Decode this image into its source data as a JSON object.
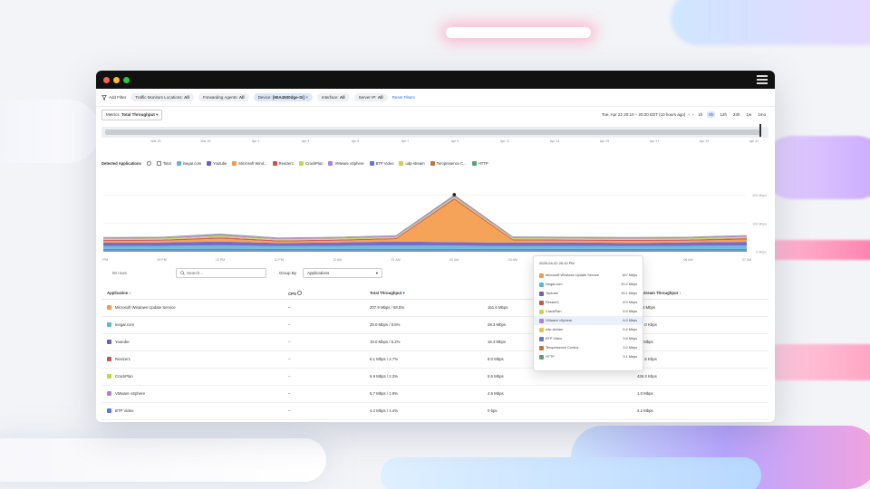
{
  "window": {
    "menu_icon": "hamburger-icon"
  },
  "filters": {
    "add_filter": "Add Filter",
    "chips": [
      {
        "label": "Traffic Monitors Locations:",
        "value": "All"
      },
      {
        "label": "Forwarding Agents:",
        "value": "All"
      },
      {
        "label": "Device:",
        "value": "[MIA4500dge-SI]"
      },
      {
        "label": "Interface:",
        "value": "All"
      },
      {
        "label": "Server IP:",
        "value": "All"
      }
    ],
    "reset": "Reset Filters"
  },
  "metrics": {
    "label": "Metrics:",
    "value": "Total Throughput",
    "time_range": "Tue, Apr 22 20:10 – 20:20 EDT (10 hours ago)",
    "buttons": [
      "1h",
      "6h",
      "12h",
      "24h",
      "1w",
      "1mo"
    ],
    "active_button": "6h"
  },
  "timeline": {
    "labels": [
      "Mar 28",
      "Mar 30",
      "Apr 1",
      "Apr 3",
      "Apr 5",
      "Apr 7",
      "Apr 9",
      "Apr 11",
      "Apr 13",
      "Apr 15",
      "Apr 17",
      "Apr 19",
      "Apr 21"
    ]
  },
  "legend": {
    "title": "Detected Applications",
    "total_label": "Total",
    "items": [
      {
        "name": "inegar.com",
        "color": "#5fb7d7"
      },
      {
        "name": "Youtube",
        "color": "#6d5ec4"
      },
      {
        "name": "Microsoft Wind...",
        "color": "#f39b4b"
      },
      {
        "name": "Resizer1",
        "color": "#d0504e"
      },
      {
        "name": "CrackPlan",
        "color": "#c6d64a"
      },
      {
        "name": "VMware vSphere",
        "color": "#b07fd6"
      },
      {
        "name": "BTP Video",
        "color": "#5b7ad6"
      },
      {
        "name": "udp-stream",
        "color": "#e7c547"
      },
      {
        "name": "Teropresence C...",
        "color": "#bf7445"
      },
      {
        "name": "HTTP",
        "color": "#5aa07a"
      }
    ]
  },
  "chart_data": {
    "type": "area",
    "x": [
      "08 PM",
      "09 PM",
      "10 PM",
      "11 PM",
      "12 AM",
      "01 AM",
      "02 AM",
      "03 AM",
      "04 AM",
      "05 AM",
      "06 AM",
      "07 AM"
    ],
    "ylabels": [
      "200 Mbps",
      "100 Mbps",
      "0 Mbps"
    ],
    "ylim": [
      0,
      250
    ],
    "series": [
      {
        "name": "HTTP",
        "color": "#5aa07a",
        "values": [
          4,
          4,
          4,
          4,
          4,
          4,
          4,
          4,
          4,
          4,
          4,
          4
        ]
      },
      {
        "name": "BTP Video",
        "color": "#5b7ad6",
        "values": [
          6,
          6,
          7,
          6,
          6,
          6,
          6,
          6,
          6,
          6,
          6,
          6
        ]
      },
      {
        "name": "inegar.com",
        "color": "#5fb7d7",
        "values": [
          10,
          11,
          12,
          10,
          11,
          12,
          12,
          10,
          11,
          10,
          11,
          12
        ]
      },
      {
        "name": "Youtube",
        "color": "#6d5ec4",
        "values": [
          12,
          12,
          13,
          11,
          12,
          14,
          12,
          12,
          12,
          11,
          12,
          13
        ]
      },
      {
        "name": "Microsoft Wind...",
        "color": "#f39b4b",
        "values": [
          6,
          6,
          10,
          5,
          6,
          8,
          150,
          8,
          6,
          7,
          6,
          8
        ]
      },
      {
        "name": "Resizer1",
        "color": "#d0504e",
        "values": [
          4,
          4,
          5,
          4,
          4,
          4,
          5,
          4,
          4,
          4,
          4,
          5
        ]
      },
      {
        "name": "CrackPlan",
        "color": "#c6d64a",
        "values": [
          4,
          4,
          5,
          4,
          4,
          4,
          5,
          4,
          4,
          4,
          4,
          5
        ]
      },
      {
        "name": "VMware vSphere",
        "color": "#b07fd6",
        "values": [
          3,
          3,
          4,
          3,
          3,
          3,
          4,
          3,
          3,
          3,
          3,
          3
        ]
      },
      {
        "name": "Teropresence C...",
        "color": "#8a8f99",
        "values": [
          3,
          3,
          4,
          3,
          3,
          3,
          4,
          3,
          3,
          3,
          3,
          3
        ]
      }
    ]
  },
  "tooltip": {
    "time": "2025-04-22 20:10 PM",
    "rows": [
      {
        "name": "Microsoft Windows Update Service",
        "value": "167 Mbps",
        "color": "#f39b4b"
      },
      {
        "name": "inegar.com",
        "value": "20.2 Mbps",
        "color": "#5fb7d7"
      },
      {
        "name": "Youtube",
        "value": "15.1 Mbps",
        "color": "#6d5ec4"
      },
      {
        "name": "Resizer1",
        "value": "8.9 Mbps",
        "color": "#d0504e"
      },
      {
        "name": "CrackPlan",
        "value": "6.5 Mbps",
        "color": "#c6d64a"
      },
      {
        "name": "VMware vSphere",
        "value": "6.9 Mbps",
        "color": "#b07fd6",
        "highlight": true
      },
      {
        "name": "udp-stream",
        "value": "5.4 Mbps",
        "color": "#e7c547"
      },
      {
        "name": "BTP Video",
        "value": "3.6 Mbps",
        "color": "#5b7ad6"
      },
      {
        "name": "Teropresence Control",
        "value": "3.2 Mbps",
        "color": "#bf7445"
      },
      {
        "name": "HTTP",
        "value": "3.1 Mbps",
        "color": "#5aa07a"
      }
    ]
  },
  "tablebar": {
    "count": "50 rows",
    "search_placeholder": "Search...",
    "group_by_label": "Group By",
    "group_by_value": "Applications"
  },
  "table": {
    "headers": [
      "Application",
      "CPS",
      "Total Throughput",
      "",
      "Upstream Throughput"
    ],
    "rows": [
      {
        "app": "Microsoft Windows Update Service",
        "color": "#f39b4b",
        "cps": "–",
        "total": "207.9 Mbps / 68.5%",
        "down": "161.6 Mbps",
        "up": "36.3 Mbps"
      },
      {
        "app": "inegar.com",
        "color": "#5fb7d7",
        "cps": "–",
        "total": "29.0 Mbps / 9.5%",
        "down": "28.3 Mbps",
        "up": "732.0 Kbps"
      },
      {
        "app": "Youtube",
        "color": "#6d5ec4",
        "cps": "–",
        "total": "19.0 Mbps / 6.2%",
        "down": "15.3 Mbps",
        "up": "3.4 Mbps"
      },
      {
        "app": "Resizer1",
        "color": "#d0504e",
        "cps": "–",
        "total": "8.1 Mbps / 2.7%",
        "down": "8.0 Mbps",
        "up": "176.5 Kbps"
      },
      {
        "app": "CrackPlan",
        "color": "#c6d64a",
        "cps": "–",
        "total": "6.9 Mbps / 2.3%",
        "down": "6.5 Mbps",
        "up": "426.3 Kbps"
      },
      {
        "app": "VMware vSphere",
        "color": "#b07fd6",
        "cps": "–",
        "total": "5.7 Mbps / 1.9%",
        "down": "4.6 Mbps",
        "up": "1.0 Mbps"
      },
      {
        "app": "BTP Video",
        "color": "#5b7ad6",
        "cps": "–",
        "total": "4.2 Mbps / 1.4%",
        "down": "0 bps",
        "up": "4.2 Mbps"
      }
    ]
  }
}
